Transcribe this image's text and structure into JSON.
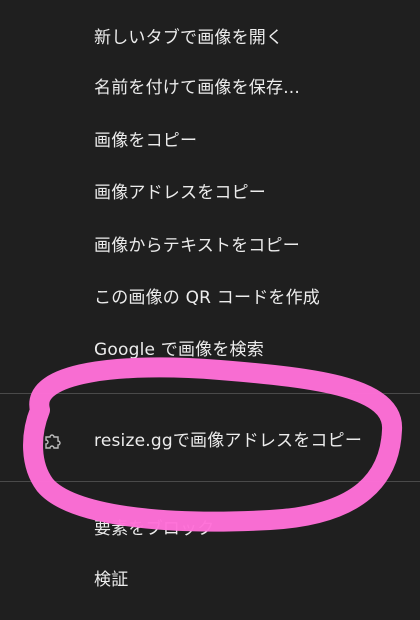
{
  "context_menu": {
    "items": [
      {
        "label": "新しいタブで画像を開く"
      },
      {
        "label": "名前を付けて画像を保存..."
      },
      {
        "label": "画像をコピー"
      },
      {
        "label": "画像アドレスをコピー"
      },
      {
        "label": "画像からテキストをコピー"
      },
      {
        "label": "この画像の QR コードを作成"
      },
      {
        "label": "Google で画像を検索"
      }
    ],
    "extension_item": {
      "label": "resize.ggで画像アドレスをコピー",
      "icon": "puzzle-icon"
    },
    "bottom_items": [
      {
        "label": "要素をブロック"
      },
      {
        "label": "検証"
      }
    ]
  },
  "annotation": {
    "color": "#ff6fd8"
  }
}
